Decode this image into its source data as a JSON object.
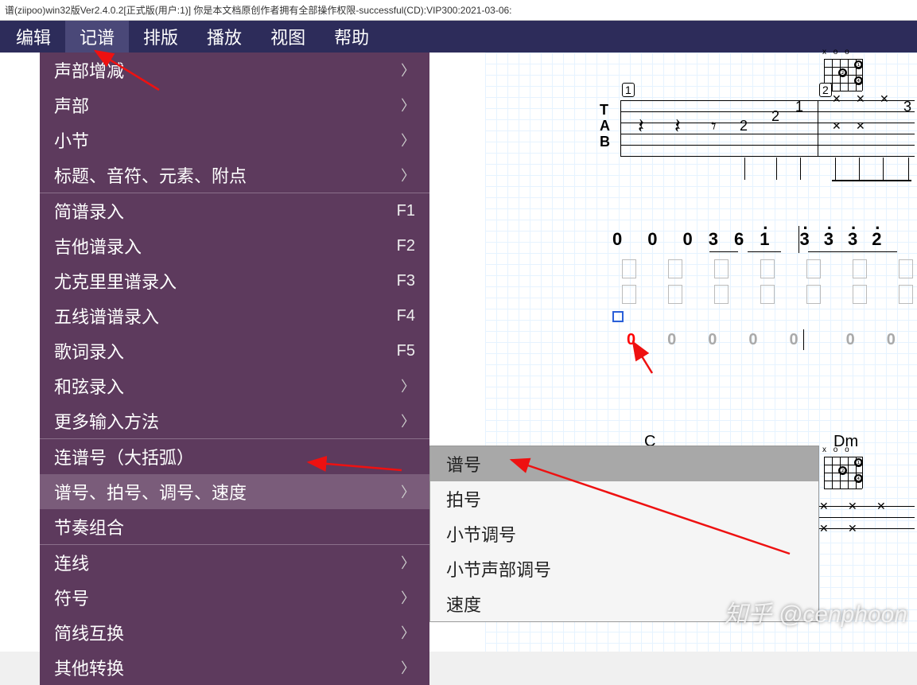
{
  "title_bar": "谱(ziipoo)win32版Ver2.4.0.2[正式版(用户:1)]  你是本文档原创作者拥有全部操作权限-successful(CD):VIP300:2021-03-06:",
  "menu": {
    "items": [
      "编辑",
      "记谱",
      "排版",
      "播放",
      "视图",
      "帮助"
    ],
    "active_index": 1
  },
  "dropdown": {
    "groups": [
      [
        {
          "label": "声部增减",
          "right": "chevron"
        },
        {
          "label": "声部",
          "right": "chevron"
        },
        {
          "label": "小节",
          "right": "chevron"
        },
        {
          "label": "标题、音符、元素、附点",
          "right": "chevron"
        }
      ],
      [
        {
          "label": "简谱录入",
          "right": "F1"
        },
        {
          "label": "吉他谱录入",
          "right": "F2"
        },
        {
          "label": "尤克里里谱录入",
          "right": "F3"
        },
        {
          "label": "五线谱谱录入",
          "right": "F4"
        },
        {
          "label": "歌词录入",
          "right": "F5"
        },
        {
          "label": "和弦录入",
          "right": "chevron"
        },
        {
          "label": "更多输入方法",
          "right": "chevron"
        }
      ],
      [
        {
          "label": "连谱号（大括弧）",
          "right": ""
        },
        {
          "label": "谱号、拍号、调号、速度",
          "right": "chevron",
          "hover": true
        },
        {
          "label": "节奏组合",
          "right": ""
        }
      ],
      [
        {
          "label": "连线",
          "right": "chevron"
        },
        {
          "label": "符号",
          "right": "chevron"
        },
        {
          "label": "简线互换",
          "right": "chevron"
        },
        {
          "label": "其他转换",
          "right": "chevron"
        }
      ]
    ]
  },
  "submenu": {
    "items": [
      "谱号",
      "拍号",
      "小节调号",
      "小节声部调号",
      "速度"
    ],
    "hover_index": 0
  },
  "canvas": {
    "tab_label_T": "T",
    "tab_label_A": "A",
    "tab_label_B": "B",
    "measure1": "1",
    "measure2": "2",
    "frets": [
      "2",
      "2",
      "1",
      "3"
    ],
    "jianpu1": [
      "0",
      "0",
      "0",
      "3",
      "6",
      "1",
      "3",
      "3",
      "3",
      "2"
    ],
    "zeros": [
      "0",
      "0",
      "0",
      "0",
      "0",
      "0",
      "0"
    ],
    "chord_c": "C",
    "chord_dm": "Dm",
    "chord_xo_top": "x o o",
    "chord_xo_dm": "x o o"
  },
  "watermark": "知乎 @cenphoon"
}
